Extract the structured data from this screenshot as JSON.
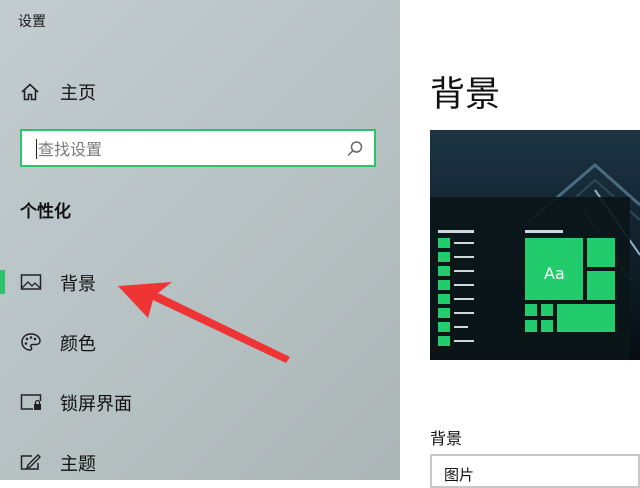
{
  "window": {
    "title": "设置"
  },
  "sidebar": {
    "home_label": "主页",
    "search_placeholder": "查找设置",
    "section_heading": "个性化",
    "items": [
      {
        "label": "背景",
        "icon": "picture-icon",
        "selected": true
      },
      {
        "label": "颜色",
        "icon": "palette-icon",
        "selected": false
      },
      {
        "label": "锁屏界面",
        "icon": "lock-screen-icon",
        "selected": false
      },
      {
        "label": "主题",
        "icon": "theme-icon",
        "selected": false
      }
    ]
  },
  "main": {
    "page_title": "背景",
    "preview_tile_text": "Aa",
    "background_label": "背景",
    "background_value": "图片"
  },
  "colors": {
    "accent": "#2bc46a",
    "annotation_arrow": "#ee3434"
  }
}
